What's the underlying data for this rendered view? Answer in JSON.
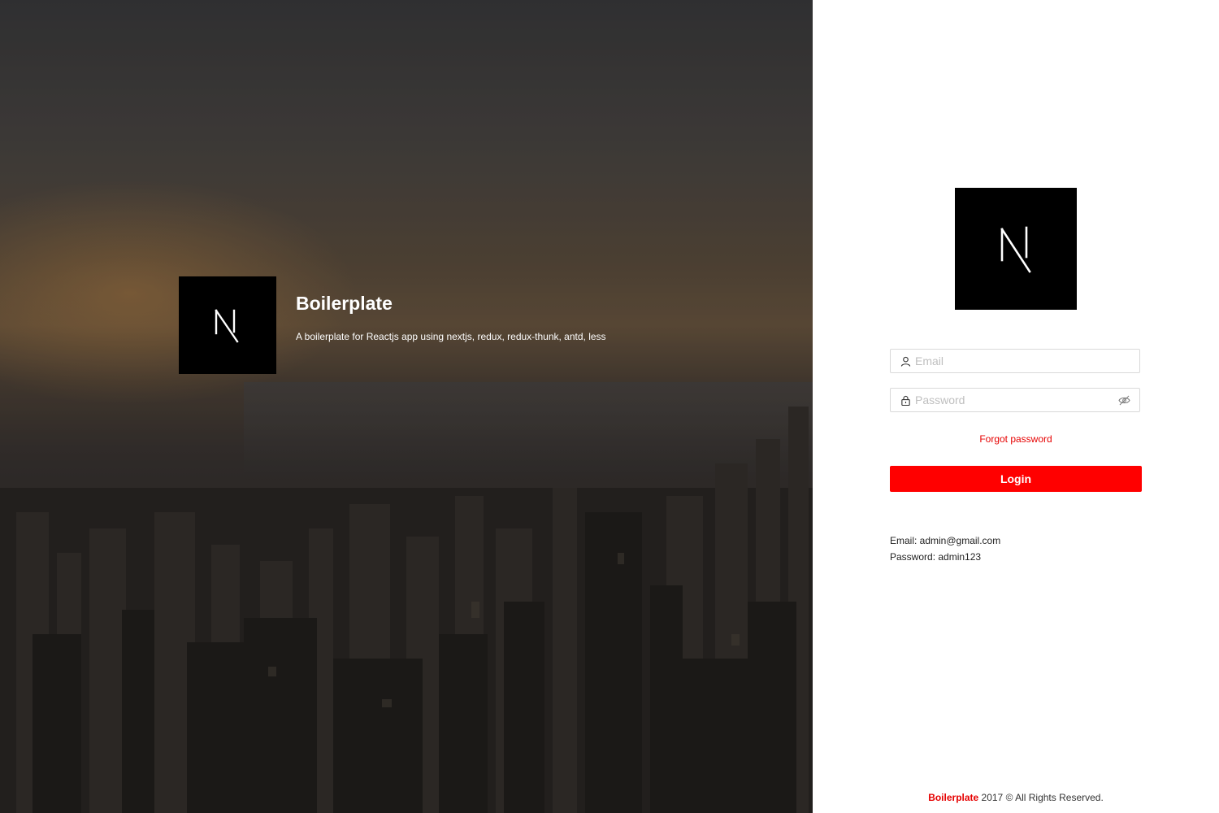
{
  "hero": {
    "logo_icon": "nextjs-logo-icon",
    "title": "Boilerplate",
    "subtitle": "A boilerplate for Reactjs app using nextjs, redux, redux-thunk, antd, less"
  },
  "login": {
    "logo_icon": "nextjs-logo-icon",
    "email": {
      "placeholder": "Email",
      "value": "",
      "icon": "user-icon"
    },
    "password": {
      "placeholder": "Password",
      "value": "",
      "icon": "lock-icon",
      "toggle_icon": "eye-invisible-icon"
    },
    "forgot_label": "Forgot password",
    "submit_label": "Login",
    "demo_email": "Email: admin@gmail.com",
    "demo_password": "Password: admin123"
  },
  "footer": {
    "brand": "Boilerplate",
    "text": " 2017 © All Rights Reserved."
  },
  "colors": {
    "accent": "#ff0000",
    "link": "#e60000",
    "logo_bg": "#000000"
  }
}
